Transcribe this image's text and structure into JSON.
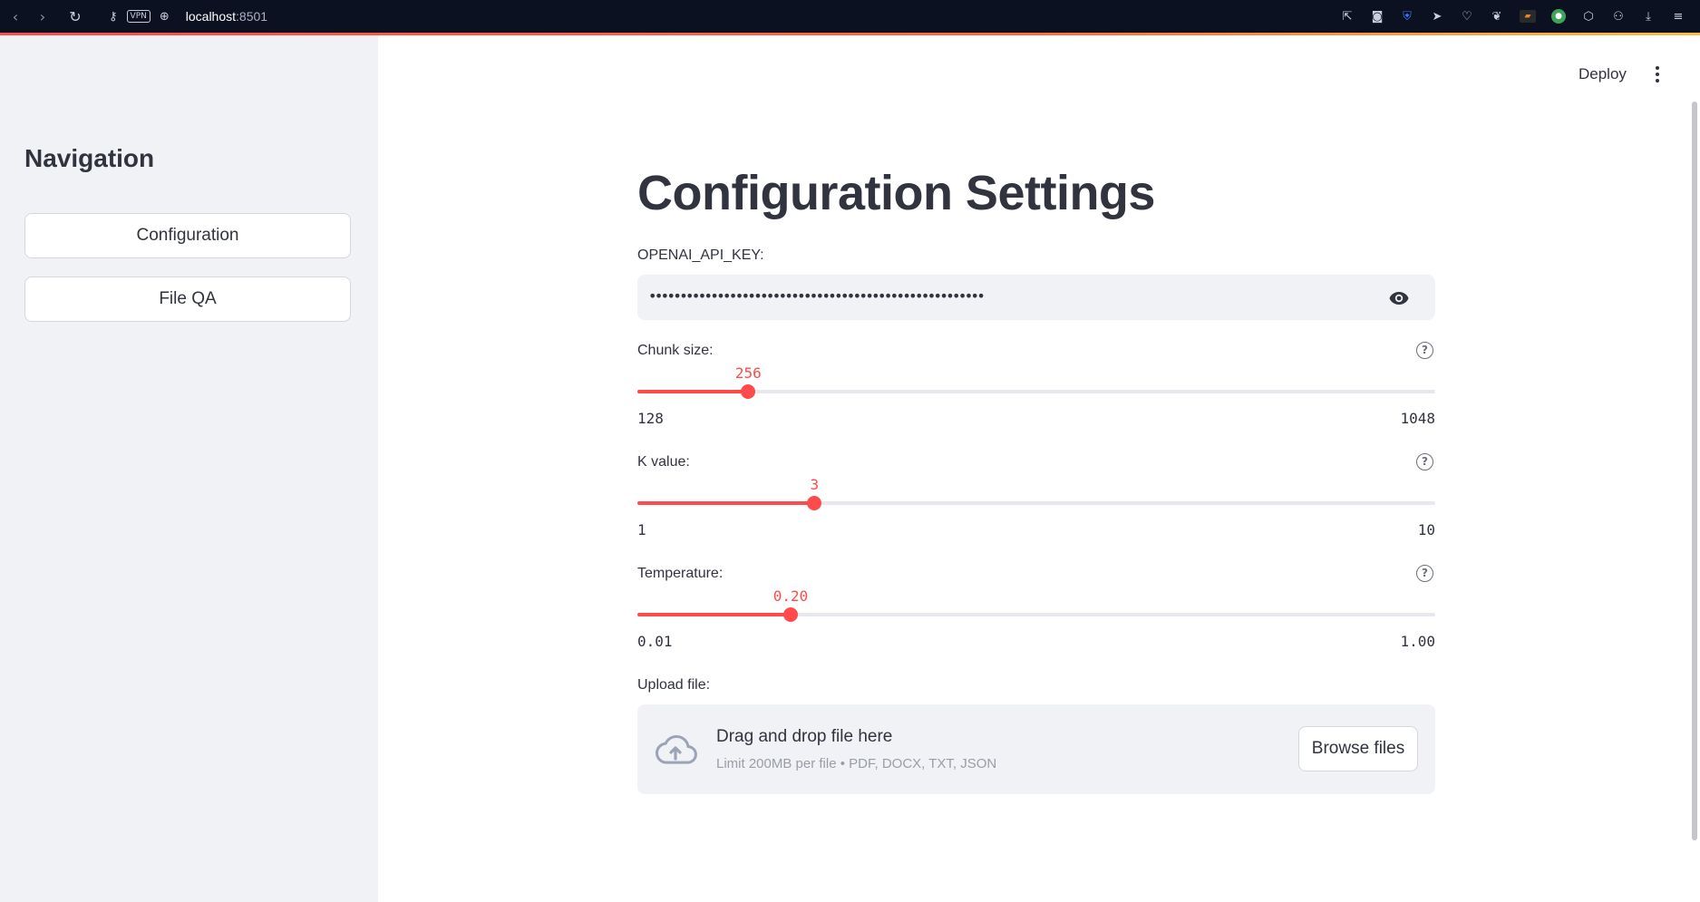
{
  "browser": {
    "url_host": "localhost",
    "url_port": ":8501",
    "vpn_label": "VPN"
  },
  "sidebar": {
    "title": "Navigation",
    "items": [
      {
        "label": "Configuration"
      },
      {
        "label": "File QA"
      }
    ]
  },
  "header": {
    "deploy_label": "Deploy"
  },
  "main": {
    "title": "Configuration Settings",
    "api_key": {
      "label": "OPENAI_API_KEY:",
      "masked_value": "••••••••••••••••••••••••••••••••••••••••••••••••••••••"
    },
    "sliders": [
      {
        "label": "Chunk size:",
        "value": "256",
        "min": "128",
        "max": "1048",
        "fraction": 0.139,
        "help": "?"
      },
      {
        "label": "K value:",
        "value": "3",
        "min": "1",
        "max": "10",
        "fraction": 0.222,
        "help": "?"
      },
      {
        "label": "Temperature:",
        "value": "0.20",
        "min": "0.01",
        "max": "1.00",
        "fraction": 0.192,
        "help": "?"
      }
    ],
    "upload": {
      "label": "Upload file:",
      "title": "Drag and drop file here",
      "subtitle": "Limit 200MB per file • PDF, DOCX, TXT, JSON",
      "button": "Browse files"
    }
  },
  "colors": {
    "accent": "#ff4b4b",
    "sidebar_bg": "#f0f2f6",
    "text": "#31333f"
  }
}
